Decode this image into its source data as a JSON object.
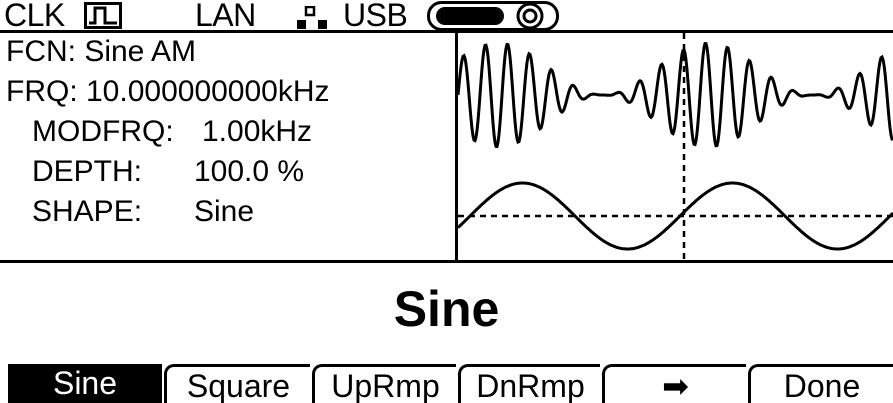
{
  "status_bar": {
    "clk_label": "CLK",
    "clk_icon": "square-pulse-icon",
    "lan_label": "LAN",
    "lan_icon": "network-nodes-icon",
    "usb_label": "USB",
    "usb_icon": "usb-connector-icon"
  },
  "info": {
    "fcn_line": "FCN: Sine AM",
    "frq_line": "FRQ: 10.000000000kHz",
    "modfrq_label": "MODFRQ:",
    "modfrq_value": "1.00kHz",
    "depth_label": "DEPTH:",
    "depth_value": "100.0 %",
    "shape_label": "SHAPE:",
    "shape_value": "Sine"
  },
  "waveform": {
    "carrier": "AM modulated sine",
    "modulation": "sine"
  },
  "selection": {
    "value": "Sine"
  },
  "softkeys": [
    {
      "label": "Sine",
      "active": true
    },
    {
      "label": "Square",
      "active": false
    },
    {
      "label": "UpRmp",
      "active": false
    },
    {
      "label": "DnRmp",
      "active": false
    },
    {
      "label": "➡",
      "active": false,
      "icon": "right-arrow-icon"
    },
    {
      "label": "Done",
      "active": false
    }
  ],
  "colors": {
    "foreground": "#000000",
    "background": "#ffffff"
  }
}
